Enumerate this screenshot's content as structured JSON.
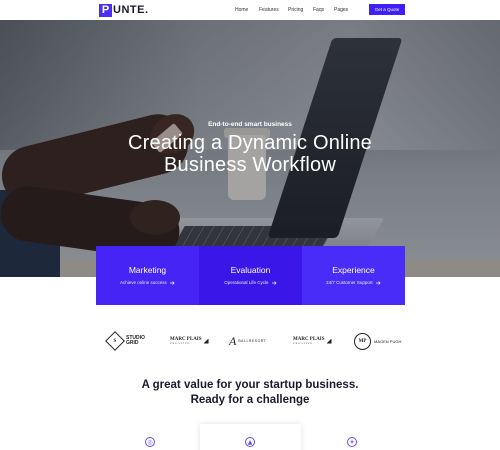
{
  "header": {
    "logo_letter": "P",
    "logo_rest": "UNTE.",
    "nav": [
      {
        "label": "Home",
        "name": "nav-home"
      },
      {
        "label": "Features",
        "name": "nav-features"
      },
      {
        "label": "Pricing",
        "name": "nav-pricing"
      },
      {
        "label": "Faqs",
        "name": "nav-faqs"
      },
      {
        "label": "Pages",
        "name": "nav-pages"
      }
    ],
    "cta_label": "Get a Quote",
    "accent_color": "#3f1ff5"
  },
  "hero": {
    "eyebrow": "End-to-end smart business",
    "title_line1": "Creating a Dynamic Online",
    "title_line2": "Business Workflow"
  },
  "cards": [
    {
      "title": "Marketing",
      "subtitle": "Achieve online success",
      "icon": "arrow-right-icon"
    },
    {
      "title": "Evaluation",
      "subtitle": "Operational Life Cycle",
      "icon": "arrow-right-icon"
    },
    {
      "title": "Experience",
      "subtitle": "24/7 Customer Support",
      "icon": "arrow-right-icon"
    }
  ],
  "partners": {
    "studio_mark": "S",
    "studio_line1": "STUDIO",
    "studio_line2": "GRID",
    "marc1_name": "MARC PLAIS",
    "marc1_sub": "CREATIVE",
    "ball_mark": "A",
    "ball_text": "BALLRESORT",
    "marc2_name": "MARC PLAIS",
    "marc2_sub": "CREATIVE",
    "circle_mark": "MP",
    "circle_text": "MAGEN PUGH"
  },
  "value": {
    "line1": "A great value for your startup business.",
    "line2": "Ready for a challenge"
  },
  "features_row": {
    "icons": [
      "target-icon",
      "rocket-icon",
      "lightbulb-icon"
    ]
  }
}
